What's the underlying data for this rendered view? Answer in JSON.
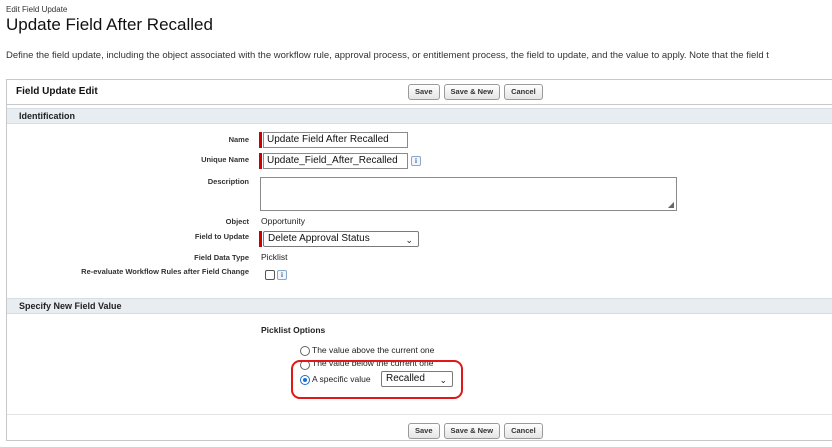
{
  "page": {
    "breadcrumb": "Edit Field Update",
    "title": "Update Field After Recalled",
    "description": "Define the field update, including the object associated with the workflow rule, approval process, or entitlement process, the field to update, and the value to apply. Note that the field t"
  },
  "panel": {
    "title": "Field Update Edit",
    "buttons": {
      "save": "Save",
      "save_new": "Save & New",
      "cancel": "Cancel"
    }
  },
  "identification": {
    "heading": "Identification",
    "name_label": "Name",
    "name_value": "Update Field After Recalled",
    "unique_label": "Unique Name",
    "unique_value": "Update_Field_After_Recalled",
    "description_label": "Description",
    "object_label": "Object",
    "object_value": "Opportunity",
    "field_label": "Field to Update",
    "field_value": "Delete Approval Status",
    "datatype_label": "Field Data Type",
    "datatype_value": "Picklist",
    "reeval_label": "Re-evaluate Workflow Rules after Field Change"
  },
  "new_value": {
    "heading": "Specify New Field Value",
    "picklist_heading": "Picklist Options",
    "opt_above": "The value above the current one",
    "opt_below": "The value below the current one",
    "opt_specific": "A specific value",
    "specific_value": "Recalled"
  },
  "colors": {
    "highlight": "#e01818",
    "required": "#cc0000",
    "section_bg": "#e8edf1"
  },
  "icons": {
    "info": "info-icon",
    "chevron": "chevron-down-icon",
    "resize": "resize-grip-icon"
  }
}
